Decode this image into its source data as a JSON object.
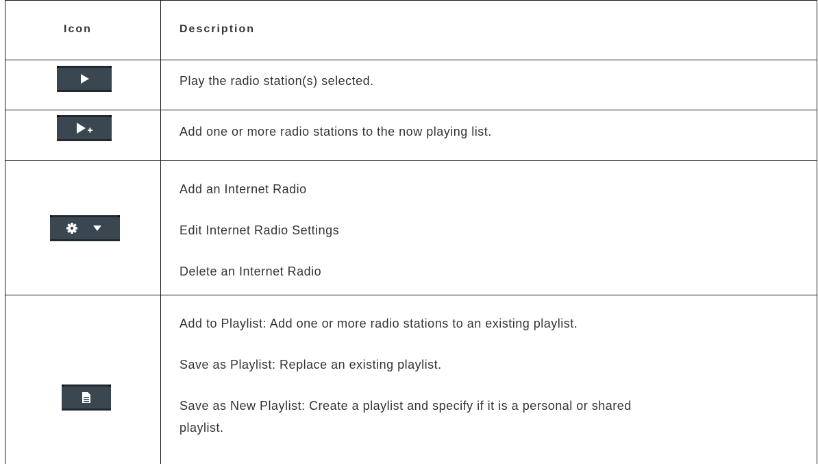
{
  "table": {
    "headers": {
      "icon": "Icon",
      "description": "Description"
    },
    "rows": [
      {
        "icon": "play-icon",
        "lines": [
          "Play the radio station(s) selected."
        ]
      },
      {
        "icon": "play-add-icon",
        "lines": [
          "Add one or more radio stations to the now playing list."
        ]
      },
      {
        "icon": "gear-dropdown-icon",
        "lines": [
          "Add an Internet Radio",
          "Edit Internet Radio Settings",
          "Delete an Internet Radio"
        ]
      },
      {
        "icon": "playlist-document-icon",
        "lines": [
          "Add to Playlist: Add one or more radio stations to an existing playlist.",
          "Save as Playlist: Replace an existing playlist.",
          "Save as New Playlist: Create a playlist and specify if it is a personal or shared",
          "playlist."
        ]
      }
    ]
  },
  "colors": {
    "button_bg": "#3a4650",
    "button_border": "#222a30",
    "text": "#333333",
    "grid": "#1a1a1a"
  }
}
